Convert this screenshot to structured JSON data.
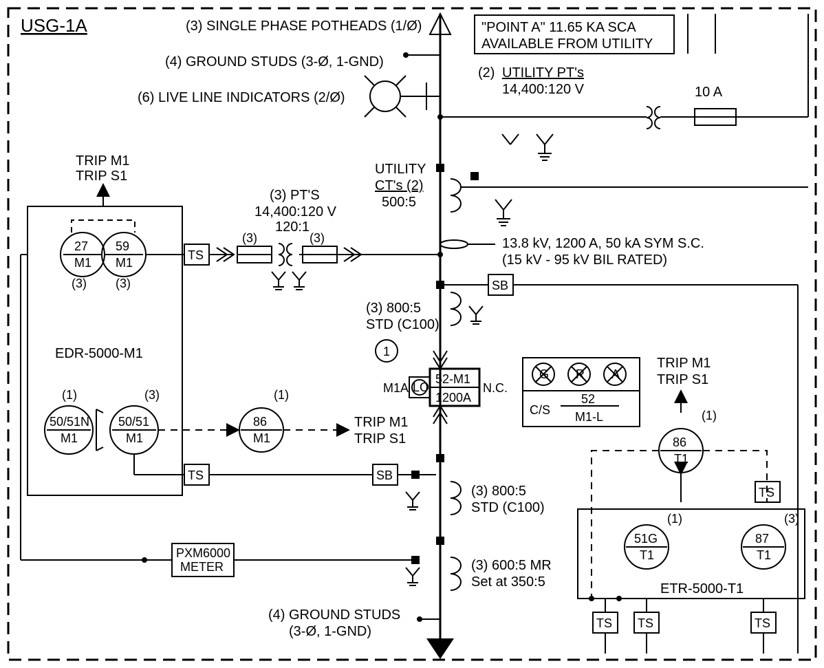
{
  "title": "USG-1A",
  "top": {
    "potheads": "(3) SINGLE PHASE POTHEADS (1/Ø)",
    "groundstuds": "(4) GROUND STUDS (3-Ø, 1-GND)",
    "liveline": "(6) LIVE LINE INDICATORS (2/Ø)",
    "pointa1": "\"POINT A\" 11.65 KA SCA",
    "pointa2": "AVAILABLE FROM UTILITY"
  },
  "utility_pt": {
    "qty": "(2)",
    "name": "UTILITY PT's",
    "ratio": "14,400:120 V",
    "fuse": "10 A"
  },
  "utility_ct": {
    "name": "UTILITY",
    "sub": "CT's (2)",
    "ratio": "500:5"
  },
  "pts": {
    "qty": "(3) PT'S",
    "ratio": "14,400:120 V",
    "ratio2": "120:1",
    "n3a": "(3)",
    "n3b": "(3)"
  },
  "bus": {
    "l1": "13.8 kV, 1200 A, 50 kA SYM S.C.",
    "l2": "(15 kV - 95 kV BIL RATED)"
  },
  "ct1": {
    "l1": "(3) 800:5",
    "l2": "STD (C100)"
  },
  "ct2": {
    "l1": "(3) 800:5",
    "l2": "STD (C100)"
  },
  "ct3": {
    "l1": "(3) 600:5 MR",
    "l2": "Set at 350:5"
  },
  "breaker": {
    "num": "1",
    "m1a": "M1A",
    "lo": "LO",
    "dev": "52-M1",
    "amps": "1200A",
    "nc": "N.C."
  },
  "relays_left": {
    "trip1": "TRIP M1",
    "trip2": "TRIP S1",
    "r27": "27",
    "r59": "59",
    "m1": "M1",
    "n3a": "(3)",
    "n3b": "(3)",
    "box": "EDR-5000-M1",
    "r5051n": "50/51N",
    "r5051": "50/51",
    "n1": "(1)",
    "nn3": "(3)"
  },
  "relay86": {
    "n": "(1)",
    "dev": "86",
    "targ": "M1",
    "trip1": "TRIP M1",
    "trip2": "TRIP S1"
  },
  "tsbox": "TS",
  "sbbox": "SB",
  "lights": {
    "g": "G",
    "r": "R",
    "a": "A",
    "cs": "C/S",
    "dev": "52",
    "targ": "M1-L",
    "trip1": "TRIP M1",
    "trip2": "TRIP S1"
  },
  "right86": {
    "dev": "86",
    "targ": "T1",
    "n": "(1)"
  },
  "etr": {
    "r51g": "51G",
    "r87": "87",
    "t1": "T1",
    "n1": "(1)",
    "n3": "(3)",
    "box": "ETR-5000-T1"
  },
  "pxm": {
    "l1": "PXM6000",
    "l2": "METER"
  },
  "bottom": {
    "gs1": "(4) GROUND STUDS",
    "gs2": "(3-Ø, 1-GND)"
  }
}
